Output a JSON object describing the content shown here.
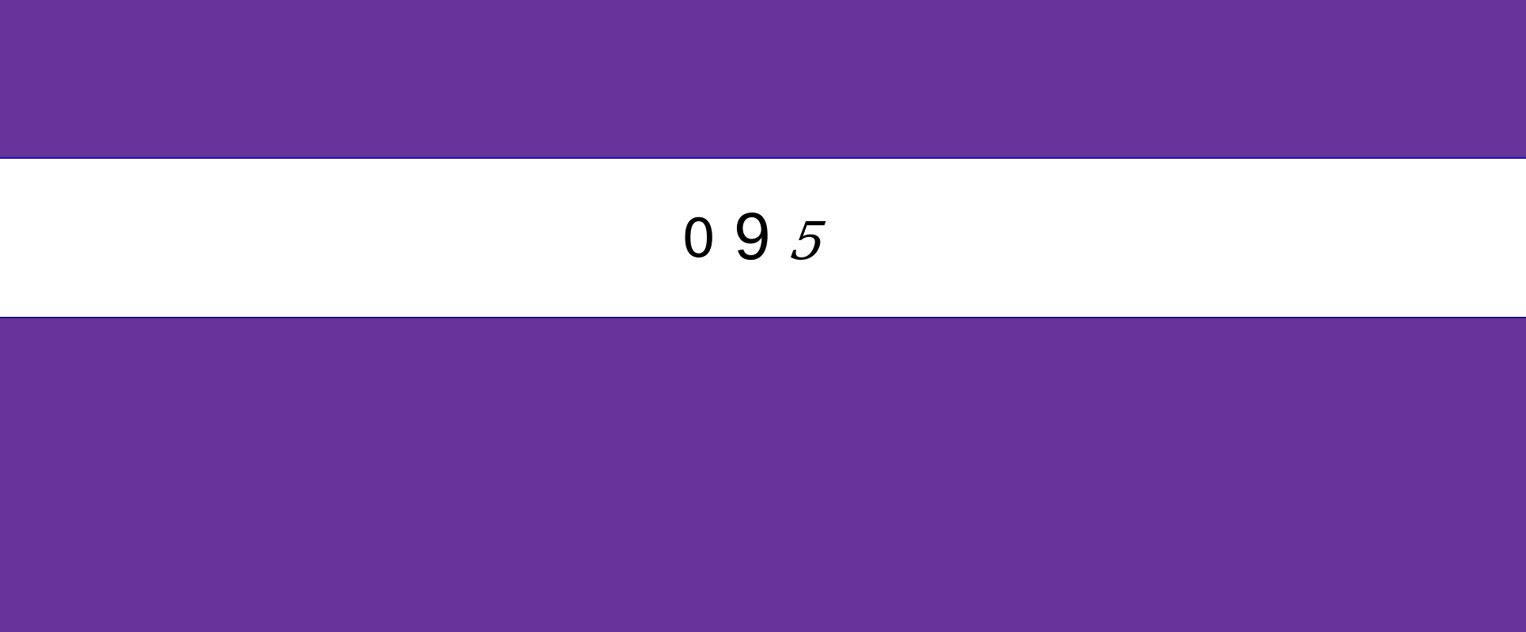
{
  "captcha": {
    "characters": [
      "0",
      "9",
      "5"
    ]
  },
  "colors": {
    "background": "#663399",
    "band": "#ffffff",
    "border_top": "#1a10b8",
    "border_bottom": "#1a1a7a",
    "text": "#000000"
  }
}
